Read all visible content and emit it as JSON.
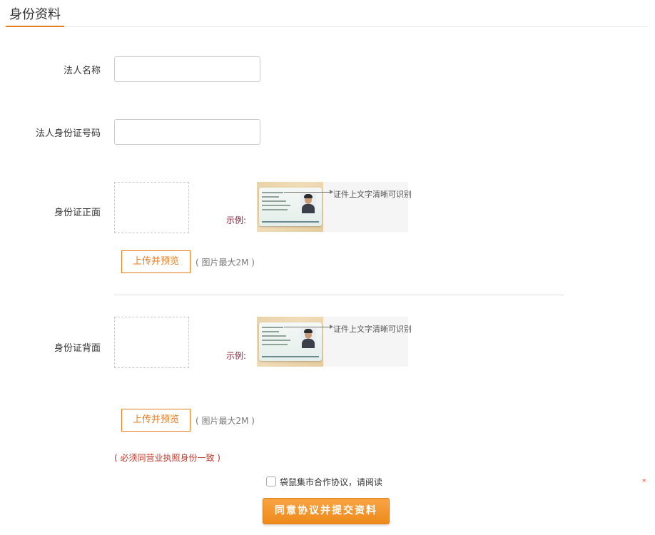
{
  "section": {
    "title": "身份资料"
  },
  "fields": {
    "legal_name_label": "法人名称",
    "legal_name_value": "",
    "legal_id_label": "法人身份证号码",
    "legal_id_value": ""
  },
  "id_front": {
    "label": "身份证正面",
    "example_label": "示例:",
    "example_caption": "证件上文字清晰可识别",
    "upload_button": "上传并预览",
    "size_note": "( 图片最大2M )"
  },
  "id_back": {
    "label": "身份证背面",
    "example_label": "示例:",
    "example_caption": "证件上文字清晰可识别",
    "upload_button": "上传并预览",
    "size_note": "( 图片最大2M )"
  },
  "warning": "( 必须同营业执照身份一致 )",
  "agreement": {
    "checked": false,
    "text": "袋鼠集市合作协议，请阅读",
    "required_mark": "*"
  },
  "submit": {
    "label": "同意协议并提交资料"
  },
  "colors": {
    "accent": "#e67e22",
    "warning": "#c0392b",
    "example_label": "#8b1c3a"
  }
}
